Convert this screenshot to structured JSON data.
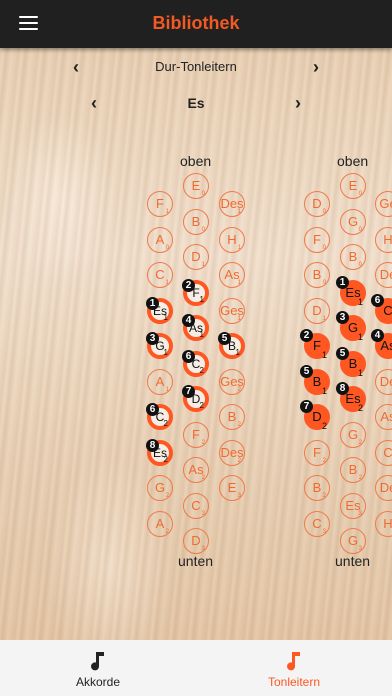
{
  "app": {
    "title": "Bibliothek"
  },
  "selector": {
    "category": "Dur-Tonleitern",
    "key": "Es"
  },
  "labels": {
    "top": "oben",
    "bottom": "unten"
  },
  "left_board": {
    "col1": [
      {
        "note": "F",
        "sub": "1",
        "state": "outline"
      },
      {
        "note": "A",
        "sub": "0",
        "state": "outline"
      },
      {
        "note": "C",
        "sub": "1",
        "state": "outline"
      },
      {
        "note": "Es",
        "sub": "1",
        "state": "active",
        "badge": "1"
      },
      {
        "note": "G",
        "sub": "1",
        "state": "active",
        "badge": "3"
      },
      {
        "note": "A",
        "sub": "1",
        "state": "outline"
      },
      {
        "note": "C",
        "sub": "2",
        "state": "active",
        "badge": "6"
      },
      {
        "note": "Es",
        "sub": "2",
        "state": "active",
        "badge": "8"
      },
      {
        "note": "G",
        "sub": "2",
        "state": "outline"
      },
      {
        "note": "A",
        "sub": "2",
        "state": "outline"
      }
    ],
    "col2": [
      {
        "note": "E",
        "sub": "0",
        "state": "outline"
      },
      {
        "note": "B",
        "sub": "0",
        "state": "outline"
      },
      {
        "note": "D",
        "sub": "1",
        "state": "outline"
      },
      {
        "note": "F",
        "sub": "1",
        "state": "active",
        "badge": "2"
      },
      {
        "note": "As",
        "sub": "1",
        "state": "active",
        "badge": "4"
      },
      {
        "note": "C",
        "sub": "2",
        "state": "active",
        "badge": "6"
      },
      {
        "note": "D",
        "sub": "2",
        "state": "active",
        "badge": "7"
      },
      {
        "note": "F",
        "sub": "2",
        "state": "outline"
      },
      {
        "note": "As",
        "sub": "2",
        "state": "outline"
      },
      {
        "note": "C",
        "sub": "3",
        "state": "outline"
      },
      {
        "note": "D",
        "sub": "3",
        "state": "outline"
      }
    ],
    "col3": [
      {
        "note": "Des",
        "sub": "1",
        "state": "outline"
      },
      {
        "note": "H",
        "sub": "1",
        "state": "outline"
      },
      {
        "note": "As",
        "sub": "1",
        "state": "outline"
      },
      {
        "note": "Ges",
        "sub": "1",
        "state": "outline"
      },
      {
        "note": "B",
        "sub": "1",
        "state": "active",
        "badge": "5"
      },
      {
        "note": "Ges",
        "sub": "2",
        "state": "outline"
      },
      {
        "note": "B",
        "sub": "2",
        "state": "outline"
      },
      {
        "note": "Des",
        "sub": "2",
        "state": "outline"
      },
      {
        "note": "E",
        "sub": "3",
        "state": "outline"
      }
    ]
  },
  "right_board": {
    "col1": [
      {
        "note": "D",
        "sub": "0",
        "state": "outline"
      },
      {
        "note": "F",
        "sub": "0",
        "state": "outline"
      },
      {
        "note": "B",
        "sub": "0",
        "state": "outline"
      },
      {
        "note": "D",
        "sub": "1",
        "state": "outline"
      },
      {
        "note": "F",
        "sub": "1",
        "state": "filled",
        "badge": "2"
      },
      {
        "note": "B",
        "sub": "1",
        "state": "filled",
        "badge": "5"
      },
      {
        "note": "D",
        "sub": "2",
        "state": "filled",
        "badge": "7"
      },
      {
        "note": "F",
        "sub": "2",
        "state": "outline"
      },
      {
        "note": "B",
        "sub": "2",
        "state": "outline"
      },
      {
        "note": "C",
        "sub": "3",
        "state": "outline"
      }
    ],
    "col2": [
      {
        "note": "E",
        "sub": "0",
        "state": "outline"
      },
      {
        "note": "G",
        "sub": "0",
        "state": "outline"
      },
      {
        "note": "B",
        "sub": "0",
        "state": "outline"
      },
      {
        "note": "Es",
        "sub": "1",
        "state": "filled",
        "badge": "1"
      },
      {
        "note": "G",
        "sub": "1",
        "state": "filled",
        "badge": "3"
      },
      {
        "note": "B",
        "sub": "1",
        "state": "filled",
        "badge": "5"
      },
      {
        "note": "Es",
        "sub": "2",
        "state": "filled",
        "badge": "8"
      },
      {
        "note": "G",
        "sub": "2",
        "state": "outline"
      },
      {
        "note": "B",
        "sub": "2",
        "state": "outline"
      },
      {
        "note": "Es",
        "sub": "3",
        "state": "outline"
      },
      {
        "note": "G",
        "sub": "3",
        "state": "outline"
      }
    ],
    "col3": [
      {
        "note": "Ge",
        "sub": "",
        "state": "outline"
      },
      {
        "note": "H",
        "sub": "",
        "state": "outline"
      },
      {
        "note": "De",
        "sub": "",
        "state": "outline"
      },
      {
        "note": "C",
        "sub": "",
        "state": "filled",
        "badge": "6"
      },
      {
        "note": "As",
        "sub": "",
        "state": "filled",
        "badge": "4"
      },
      {
        "note": "De",
        "sub": "",
        "state": "outline"
      },
      {
        "note": "As",
        "sub": "",
        "state": "outline"
      },
      {
        "note": "C",
        "sub": "",
        "state": "outline"
      },
      {
        "note": "De",
        "sub": "",
        "state": "outline"
      },
      {
        "note": "H",
        "sub": "",
        "state": "outline"
      }
    ]
  },
  "tabs": [
    {
      "label": "Akkorde",
      "icon": "music-note-icon",
      "active": false
    },
    {
      "label": "Tonleitern",
      "icon": "music-note-icon",
      "active": true
    }
  ],
  "colors": {
    "accent": "#ff5722",
    "bar": "#202020",
    "tab_inactive": "#222222",
    "tab_active": "#ff5722"
  }
}
